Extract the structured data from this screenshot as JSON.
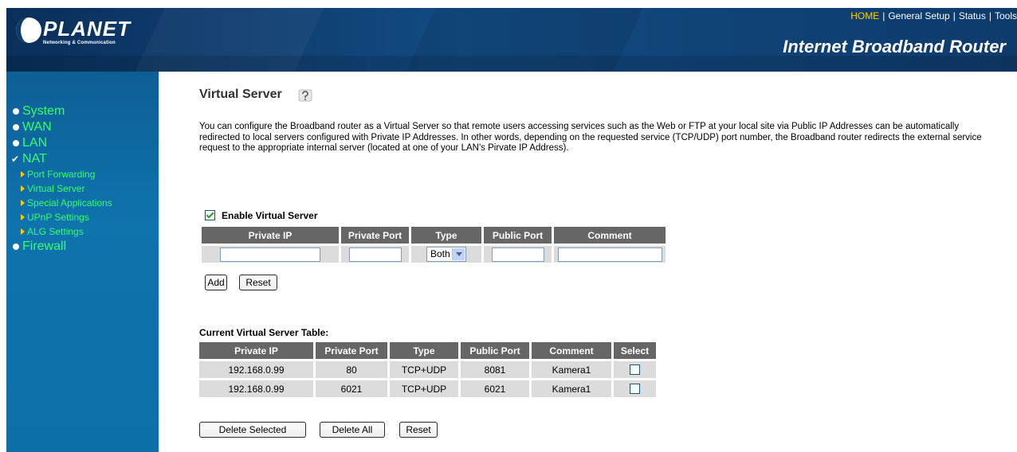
{
  "header": {
    "logo_text": "PLANET",
    "logo_subtext": "Networking & Communication",
    "product_title": "Internet Broadband Router",
    "nav": [
      {
        "label": "HOME"
      },
      {
        "label": "General Setup"
      },
      {
        "label": "Status"
      },
      {
        "label": "Tools"
      }
    ]
  },
  "sidebar": {
    "items": [
      {
        "label": "System",
        "marker": "bullet"
      },
      {
        "label": "WAN",
        "marker": "bullet"
      },
      {
        "label": "LAN",
        "marker": "bullet"
      },
      {
        "label": "NAT",
        "marker": "check",
        "expanded": true,
        "sub_items": [
          {
            "label": "Port Forwarding"
          },
          {
            "label": "Virtual Server"
          },
          {
            "label": "Special Applications"
          },
          {
            "label": "UPnP Settings"
          },
          {
            "label": "ALG Settings"
          }
        ]
      },
      {
        "label": "Firewall",
        "marker": "bullet"
      }
    ]
  },
  "main": {
    "title": "Virtual Server",
    "description": "You can configure the Broadband router as a Virtual Server so that remote users accessing services such as the Web or FTP at your local site via Public IP Addresses can be automatically redirected to local servers configured with Private IP Addresses. In other words, depending on the requested service (TCP/UDP) port number, the Broadband router redirects the external service request to the appropriate internal server (located at one of your LAN's Pirvate IP Address).",
    "enable_label": "Enable Virtual Server",
    "enable_checked": true,
    "add_form": {
      "headers": [
        "Private IP",
        "Private Port",
        "Type",
        "Public Port",
        "Comment"
      ],
      "private_ip": "",
      "private_port": "",
      "type_selected": "Both",
      "public_port": "",
      "comment": ""
    },
    "add_button": "Add",
    "reset_button": "Reset",
    "current_table_label": "Current Virtual Server Table:",
    "current_table": {
      "headers": [
        "Private IP",
        "Private Port",
        "Type",
        "Public Port",
        "Comment",
        "Select"
      ],
      "rows": [
        {
          "private_ip": "192.168.0.99",
          "private_port": "80",
          "type": "TCP+UDP",
          "public_port": "8081",
          "comment": "Kamera1",
          "selected": false
        },
        {
          "private_ip": "192.168.0.99",
          "private_port": "6021",
          "type": "TCP+UDP",
          "public_port": "6021",
          "comment": "Kamera1",
          "selected": false
        }
      ]
    },
    "delete_selected_button": "Delete Selected",
    "delete_all_button": "Delete All",
    "bottom_reset_button": "Reset"
  },
  "colors": {
    "header_bg": "#0d3b6c",
    "sidebar_bg": "#0e6ea8",
    "menu_text": "#33ff66",
    "nav_home": "#ffcc00",
    "table_header_bg": "#666666",
    "table_cell_bg": "#dcdcdc"
  }
}
